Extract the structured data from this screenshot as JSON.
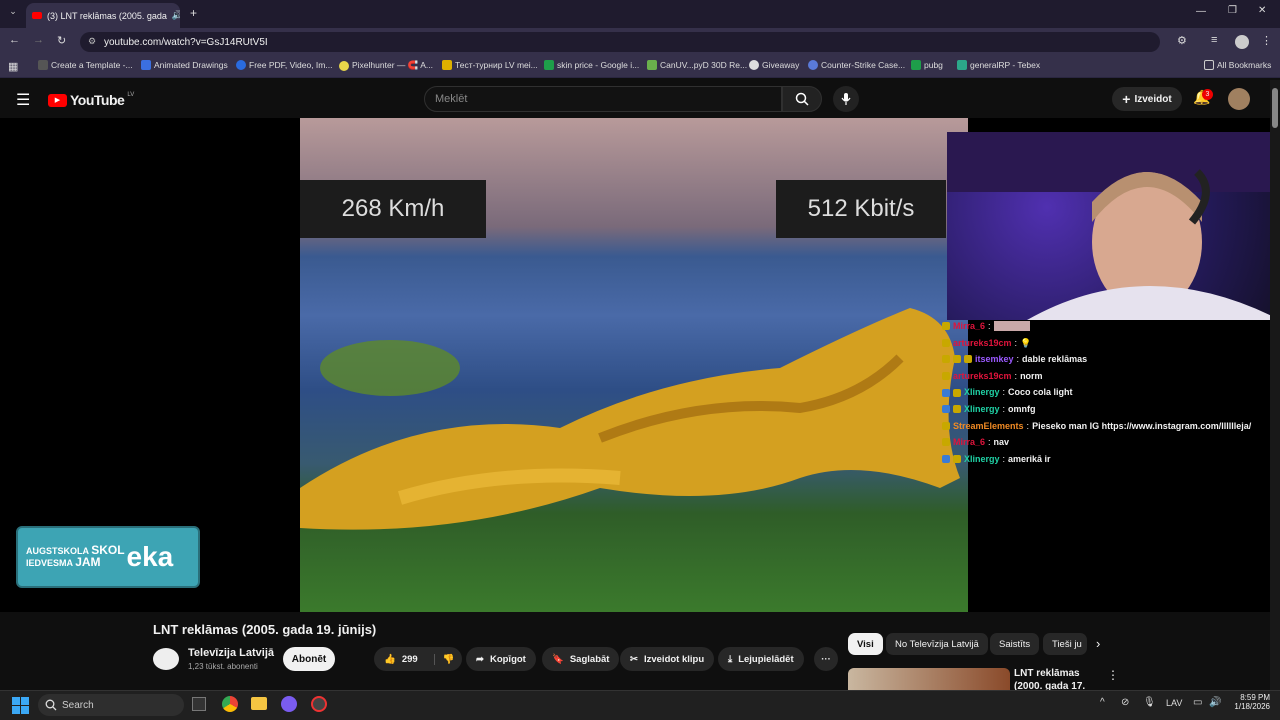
{
  "browser": {
    "tab_title": "(3) LNT reklāmas (2005. gada",
    "url": "youtube.com/watch?v=GsJ14RUtV5I",
    "bookmarks": [
      "Create a Template -...",
      "Animated Drawings",
      "Free PDF, Video, Im...",
      "Pixelhunter — 🧲 A...",
      "Тест-турнир LV mei...",
      "skin price - Google i...",
      "CanUV...pyD 30D Re...",
      "Giveaway",
      "Counter-Strike Case...",
      "pubg",
      "generalRP - Tebex"
    ],
    "all_bookmarks": "All Bookmarks"
  },
  "youtube": {
    "logo": "YouTube",
    "region": "LV",
    "search_placeholder": "Meklēt",
    "create_label": "Izveidot",
    "notif_count": "3"
  },
  "video": {
    "hud_left": "268 Km/h",
    "hud_right": "512 Kbit/s",
    "overlay_text_1": "AUGSTSKOLA",
    "overlay_text_2": "IEDVESMA",
    "overlay_text_3": "SKOL",
    "overlay_text_4": "JAM",
    "overlay_text_5": "eka"
  },
  "chat": [
    {
      "user": "Mirra_6",
      "msg": "",
      "color": "#e0143c"
    },
    {
      "user": "artureks19cm",
      "msg": "💡",
      "color": "#e0143c"
    },
    {
      "user": "itsemkey",
      "msg": "dable reklāmas",
      "color": "#9b59ff"
    },
    {
      "user": "artureks19cm",
      "msg": "norm",
      "color": "#e0143c"
    },
    {
      "user": "Xlinergy",
      "msg": "Coco cola light",
      "color": "#1fd1a5"
    },
    {
      "user": "Xlinergy",
      "msg": "omnfg",
      "color": "#1fd1a5"
    },
    {
      "user": "StreamElements",
      "msg": "Pieseko man IG https://www.instagram.com/lllllleja/",
      "color": "#f08a24"
    },
    {
      "user": "Mirra_6",
      "msg": "nav",
      "color": "#e0143c"
    },
    {
      "user": "Xlinergy",
      "msg": "amerikā ir",
      "color": "#1fd1a5"
    }
  ],
  "info": {
    "title": "LNT reklāmas (2005. gada 19. jūnijs)",
    "channel": "Televīzija Latvijā",
    "subs": "1,23 tūkst. abonenti",
    "subscribe": "Abonēt",
    "likes": "299",
    "share": "Kopīgot",
    "save": "Saglabāt",
    "clip": "Izveidot klipu",
    "download": "Lejupielādēt"
  },
  "chips": [
    "Visi",
    "No Televīzija Latvijā",
    "Saistīts",
    "Tieši ju"
  ],
  "reco": {
    "title_1": "LNT reklāmas",
    "title_2": "(2000. gada 17."
  },
  "taskbar": {
    "search": "Search",
    "lang": "LAV",
    "time": "8:59 PM",
    "date": "1/18/2026"
  }
}
